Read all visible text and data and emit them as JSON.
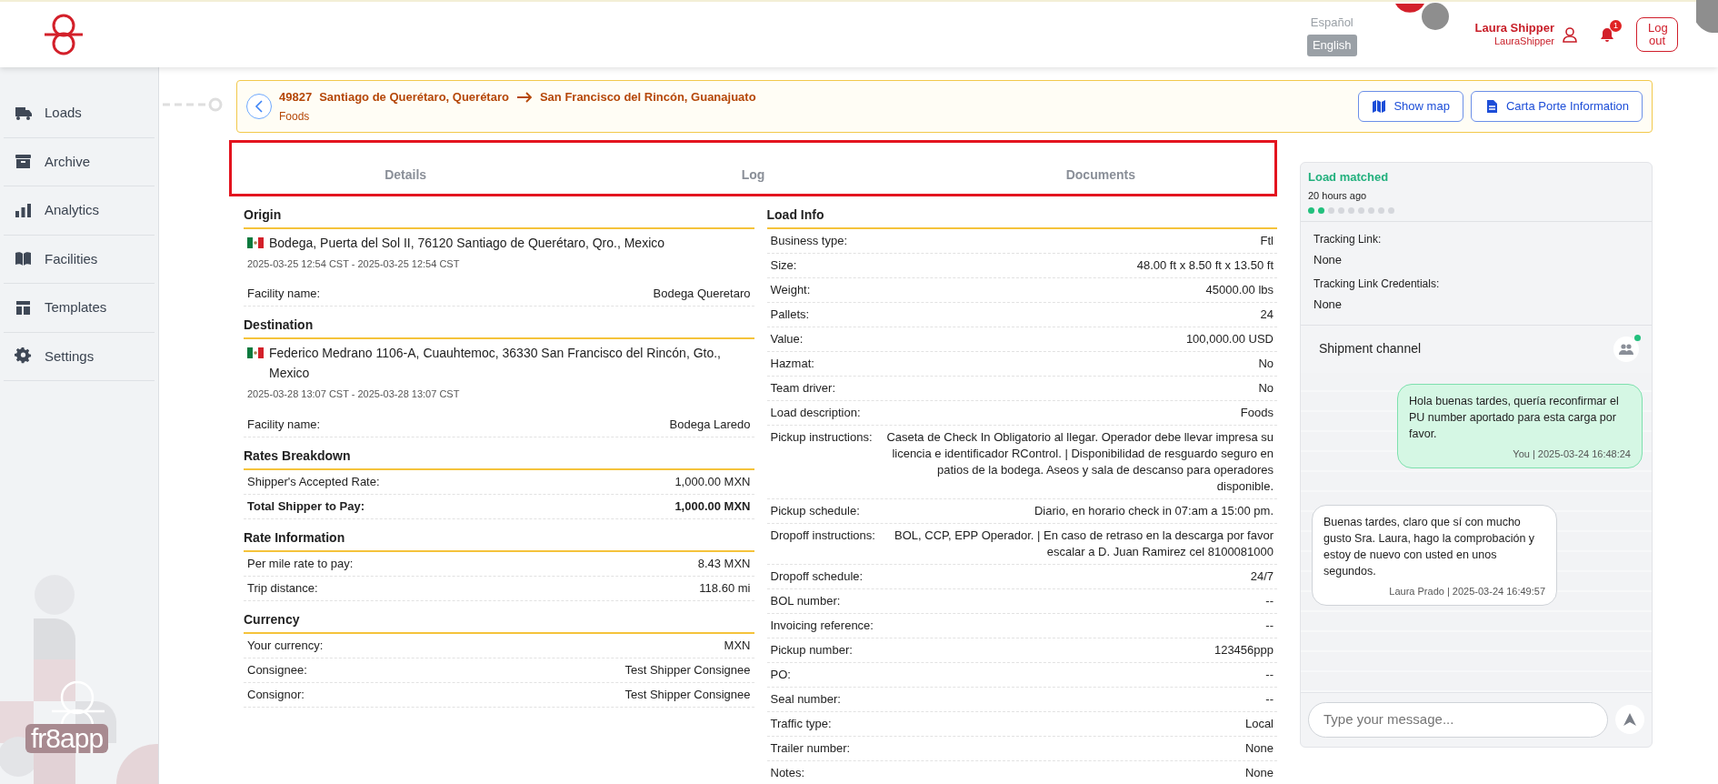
{
  "header": {
    "languages": [
      {
        "label": "Español",
        "selected": false
      },
      {
        "label": "English",
        "selected": true
      }
    ],
    "user": {
      "name": "Laura Shipper",
      "username": "LauraShipper"
    },
    "notifications": {
      "count": "1"
    },
    "logout": "Log out"
  },
  "sidebar": {
    "items": [
      {
        "label": "Loads"
      },
      {
        "label": "Archive"
      },
      {
        "label": "Analytics"
      },
      {
        "label": "Facilities"
      },
      {
        "label": "Templates"
      },
      {
        "label": "Settings"
      }
    ],
    "brand_text": "fr8app"
  },
  "load": {
    "id": "49827",
    "origin": "Santiago de Querétaro, Querétaro",
    "destination": "San Francisco del Rincón, Guanajuato",
    "description": "Foods",
    "actions": [
      {
        "label": "Show map"
      },
      {
        "label": "Carta Porte Information"
      }
    ]
  },
  "tabs": [
    {
      "label": "Details",
      "selected": false
    },
    {
      "label": "Log",
      "selected": false
    },
    {
      "label": "Documents",
      "selected": false
    }
  ],
  "left_sections": [
    {
      "title": "Origin",
      "kind": "stop",
      "address": "Bodega, Puerta del Sol II, 76120 Santiago de Querétaro, Qro., Mexico",
      "time_window": "2025-03-25 12:54 CST - 2025-03-25 12:54 CST",
      "rows": [
        {
          "label": "Facility name:",
          "value": "Bodega Queretaro",
          "emphasis": false
        }
      ]
    },
    {
      "title": "Destination",
      "kind": "stop",
      "address": "Federico Medrano 1106-A, Cuauhtemoc, 36330 San Francisco del Rincón, Gto., Mexico",
      "time_window": "2025-03-28 13:07 CST - 2025-03-28 13:07 CST",
      "rows": [
        {
          "label": "Facility name:",
          "value": "Bodega Laredo",
          "emphasis": false
        }
      ]
    },
    {
      "title": "Rates Breakdown",
      "kind": "table",
      "rows": [
        {
          "label": "Shipper's Accepted Rate:",
          "value": "1,000.00 MXN",
          "emphasis": false
        },
        {
          "label": "Total Shipper to Pay:",
          "value": "1,000.00 MXN",
          "emphasis": true
        }
      ]
    },
    {
      "title": "Rate Information",
      "kind": "table",
      "rows": [
        {
          "label": "Per mile rate to pay:",
          "value": "8.43 MXN",
          "emphasis": false
        },
        {
          "label": "Trip distance:",
          "value": "118.60 mi",
          "emphasis": false
        }
      ]
    },
    {
      "title": "Currency",
      "kind": "table",
      "rows": [
        {
          "label": "Your currency:",
          "value": "MXN",
          "emphasis": false
        },
        {
          "label": "Consignee:",
          "value": "Test Shipper Consignee",
          "emphasis": false
        },
        {
          "label": "Consignor:",
          "value": "Test Shipper Consignee",
          "emphasis": false
        }
      ]
    }
  ],
  "load_info": {
    "title": "Load Info",
    "rows": [
      {
        "label": "Business type:",
        "value": "Ftl"
      },
      {
        "label": "Size:",
        "value": "48.00 ft x 8.50 ft x 13.50 ft"
      },
      {
        "label": "Weight:",
        "value": "45000.00 lbs"
      },
      {
        "label": "Pallets:",
        "value": "24"
      },
      {
        "label": "Value:",
        "value": "100,000.00 USD"
      },
      {
        "label": "Hazmat:",
        "value": "No"
      },
      {
        "label": "Team driver:",
        "value": "No"
      },
      {
        "label": "Load description:",
        "value": "Foods"
      },
      {
        "label": "Pickup instructions:",
        "value": "Caseta de Check In Obligatorio al llegar. Operador debe llevar impresa su licencia e identificador RControl. | Disponibilidad de resguardo seguro en patios de la bodega. Aseos y sala de descanso para operadores disponible."
      },
      {
        "label": "Pickup schedule:",
        "value": "Diario, en horario check in 07:am a 15:00 pm."
      },
      {
        "label": "Dropoff instructions:",
        "value": "BOL, CCP, EPP Operador. | En caso de retraso en la descarga por favor escalar a D. Juan Ramirez cel 8100081000"
      },
      {
        "label": "Dropoff schedule:",
        "value": "24/7"
      },
      {
        "label": "BOL number:",
        "value": "--"
      },
      {
        "label": "Invoicing reference:",
        "value": "--"
      },
      {
        "label": "Pickup number:",
        "value": "123456ppp"
      },
      {
        "label": "PO:",
        "value": "--"
      },
      {
        "label": "Seal number:",
        "value": "--"
      },
      {
        "label": "Traffic type:",
        "value": "Local"
      },
      {
        "label": "Trailer number:",
        "value": "None"
      },
      {
        "label": "Notes:",
        "value": "None"
      }
    ]
  },
  "status": {
    "label": "Load matched",
    "time": "20 hours ago",
    "steps": [
      {
        "done": true
      },
      {
        "done": true
      },
      {
        "done": false
      },
      {
        "done": false
      },
      {
        "done": false
      },
      {
        "done": false
      },
      {
        "done": false
      },
      {
        "done": false
      },
      {
        "done": false
      }
    ],
    "tracking": [
      {
        "label": "Tracking Link:",
        "value": "None"
      },
      {
        "label": "Tracking Link Credentials:",
        "value": "None"
      }
    ]
  },
  "chat": {
    "title": "Shipment channel",
    "online": true,
    "messages": [
      {
        "kind": "outgoing",
        "text": "Hola buenas tardes, quería reconfirmar el PU number aportado para esta carga por favor.",
        "meta": "You | 2025-03-24 16:48:24"
      },
      {
        "kind": "incoming",
        "text": "Buenas tardes, claro que sí con mucho gusto Sra. Laura, hago la comprobación y estoy de nuevo con usted en unos segundos.",
        "meta": "Laura Prado | 2025-03-24 16:49:57"
      }
    ],
    "placeholder": "Type your message..."
  }
}
